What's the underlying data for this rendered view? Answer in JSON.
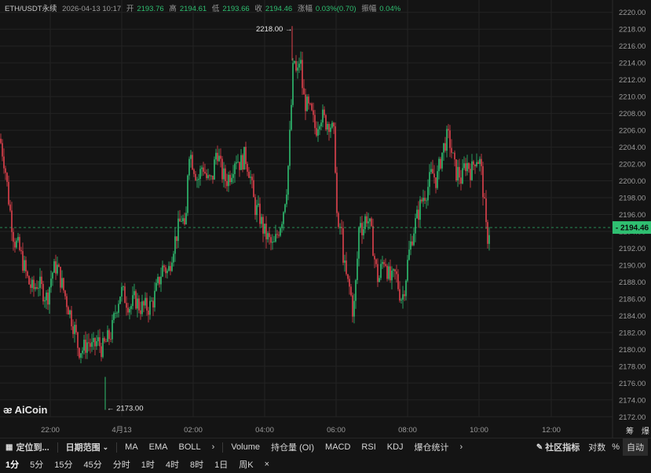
{
  "info": {
    "symbol": "ETH/USDT永续",
    "datetime": "2026-04-13 10:17",
    "open_label": "开",
    "open": "2193.76",
    "high_label": "高",
    "high": "2194.61",
    "low_label": "低",
    "low": "2193.66",
    "close_label": "收",
    "close": "2194.46",
    "change_label": "涨幅",
    "change": "0.03%(0.70)",
    "amplitude_label": "振幅",
    "amplitude": "0.04%"
  },
  "colors": {
    "up": "#2fbf71",
    "down": "#e0424d",
    "background": "#141414",
    "grid": "#232323",
    "price_tag": "#2fbf71"
  },
  "chart_data": {
    "type": "candlestick",
    "y_ticks": [
      "2220.00",
      "2218.00",
      "2216.00",
      "2214.00",
      "2212.00",
      "2210.00",
      "2208.00",
      "2206.00",
      "2204.00",
      "2202.00",
      "2200.00",
      "2198.00",
      "2196.00",
      "2194.00",
      "2192.00",
      "2190.00",
      "2188.00",
      "2186.00",
      "2184.00",
      "2182.00",
      "2180.00",
      "2178.00",
      "2176.00",
      "2174.00",
      "2172.00"
    ],
    "ylim": [
      2171,
      2221
    ],
    "x_ticks": [
      "22:00",
      "4月13",
      "02:00",
      "04:00",
      "06:00",
      "08:00",
      "10:00",
      "12:00"
    ],
    "current_price": "2194.46",
    "max_label": "2218.00",
    "min_label": "2173.00",
    "series_path": [
      [
        0,
        2205
      ],
      [
        6,
        2202
      ],
      [
        12,
        2197
      ],
      [
        18,
        2193
      ],
      [
        24,
        2192
      ],
      [
        30,
        2190
      ],
      [
        36,
        2188
      ],
      [
        42,
        2187
      ],
      [
        48,
        2188
      ],
      [
        54,
        2187
      ],
      [
        60,
        2186
      ],
      [
        66,
        2189
      ],
      [
        72,
        2190
      ],
      [
        78,
        2188
      ],
      [
        84,
        2186
      ],
      [
        90,
        2184
      ],
      [
        96,
        2182
      ],
      [
        100,
        2180
      ],
      [
        106,
        2180
      ],
      [
        112,
        2181
      ],
      [
        118,
        2180
      ],
      [
        124,
        2181
      ],
      [
        130,
        2180
      ],
      [
        136,
        2181
      ],
      [
        142,
        2182
      ],
      [
        148,
        2185
      ],
      [
        154,
        2187
      ],
      [
        160,
        2186
      ],
      [
        166,
        2185
      ],
      [
        172,
        2186
      ],
      [
        178,
        2185
      ],
      [
        184,
        2185
      ],
      [
        190,
        2185
      ],
      [
        196,
        2186
      ],
      [
        202,
        2188
      ],
      [
        208,
        2190
      ],
      [
        214,
        2189
      ],
      [
        220,
        2192
      ],
      [
        226,
        2194
      ],
      [
        232,
        2196
      ],
      [
        236,
        2193
      ],
      [
        240,
        2204
      ],
      [
        246,
        2202
      ],
      [
        252,
        2200
      ],
      [
        258,
        2202
      ],
      [
        264,
        2200
      ],
      [
        270,
        2200
      ],
      [
        276,
        2204
      ],
      [
        282,
        2201
      ],
      [
        288,
        2200
      ],
      [
        294,
        2201
      ],
      [
        300,
        2203
      ],
      [
        306,
        2202
      ],
      [
        312,
        2203
      ],
      [
        318,
        2201
      ],
      [
        324,
        2197
      ],
      [
        330,
        2196
      ],
      [
        336,
        2194
      ],
      [
        342,
        2193
      ],
      [
        348,
        2192
      ],
      [
        354,
        2194
      ],
      [
        360,
        2196
      ],
      [
        366,
        2200
      ],
      [
        370,
        2207
      ],
      [
        374,
        2215
      ],
      [
        378,
        2212
      ],
      [
        382,
        2215
      ],
      [
        386,
        2210
      ],
      [
        390,
        2209
      ],
      [
        396,
        2208
      ],
      [
        402,
        2206
      ],
      [
        408,
        2208
      ],
      [
        414,
        2207
      ],
      [
        420,
        2207
      ],
      [
        426,
        2205
      ],
      [
        430,
        2193
      ],
      [
        434,
        2195
      ],
      [
        438,
        2190
      ],
      [
        442,
        2188
      ],
      [
        446,
        2187
      ],
      [
        450,
        2184
      ],
      [
        454,
        2189
      ],
      [
        458,
        2196
      ],
      [
        462,
        2194
      ],
      [
        466,
        2196
      ],
      [
        470,
        2195
      ],
      [
        474,
        2193
      ],
      [
        478,
        2190
      ],
      [
        482,
        2188
      ],
      [
        486,
        2190
      ],
      [
        490,
        2191
      ],
      [
        494,
        2189
      ],
      [
        498,
        2188
      ],
      [
        504,
        2189
      ],
      [
        508,
        2187
      ],
      [
        512,
        2186
      ],
      [
        516,
        2188
      ],
      [
        520,
        2191
      ],
      [
        526,
        2194
      ],
      [
        532,
        2196
      ],
      [
        538,
        2198
      ],
      [
        544,
        2199
      ],
      [
        550,
        2201
      ],
      [
        556,
        2200
      ],
      [
        562,
        2203
      ],
      [
        568,
        2205
      ],
      [
        572,
        2205
      ],
      [
        576,
        2203
      ],
      [
        580,
        2201
      ],
      [
        584,
        2201
      ],
      [
        588,
        2200
      ],
      [
        592,
        2202
      ],
      [
        596,
        2202
      ],
      [
        600,
        2201
      ],
      [
        606,
        2203
      ],
      [
        612,
        2202
      ],
      [
        616,
        2198
      ],
      [
        620,
        2193
      ],
      [
        624,
        2194.5
      ]
    ]
  },
  "toolbar1": {
    "positioning": "定位到...",
    "date_range": "日期范围",
    "ma": "MA",
    "ema": "EMA",
    "boll": "BOLL",
    "arrow1": "›",
    "volume": "Volume",
    "oi": "持仓量 (OI)",
    "macd": "MACD",
    "rsi": "RSI",
    "kdj": "KDJ",
    "liquidation": "爆仓统计",
    "arrow2": "›",
    "community": "社区指标",
    "log": "对数",
    "percent": "%",
    "auto": "自动"
  },
  "toolbar2": {
    "items": [
      "1分",
      "5分",
      "15分",
      "45分",
      "分时",
      "1时",
      "4时",
      "8时",
      "1日",
      "周K"
    ],
    "close": "×"
  },
  "corner": {
    "left": "筹",
    "right": "爆"
  },
  "logo": {
    "text": "AiCoin"
  }
}
